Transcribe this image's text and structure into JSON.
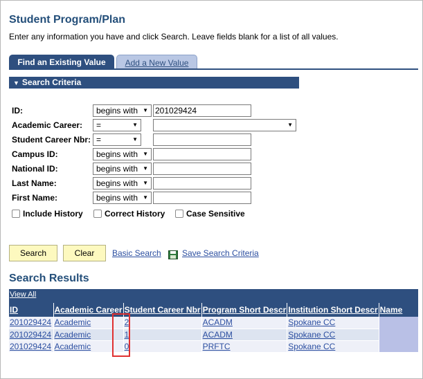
{
  "page": {
    "title": "Student Program/Plan",
    "instructions": "Enter any information you have and click Search. Leave fields blank for a list of all values."
  },
  "tabs": {
    "find_existing": "Find an Existing Value",
    "add_new": "Add a New Value"
  },
  "search_criteria": {
    "header": "Search Criteria",
    "fields": {
      "id": {
        "label": "ID:",
        "operator": "begins with",
        "value": "201029424"
      },
      "academic_career": {
        "label": "Academic Career:",
        "operator": "=",
        "value": ""
      },
      "student_career_nbr": {
        "label": "Student Career Nbr:",
        "operator": "=",
        "value": ""
      },
      "campus_id": {
        "label": "Campus ID:",
        "operator": "begins with",
        "value": ""
      },
      "national_id": {
        "label": "National ID:",
        "operator": "begins with",
        "value": ""
      },
      "last_name": {
        "label": "Last Name:",
        "operator": "begins with",
        "value": ""
      },
      "first_name": {
        "label": "First Name:",
        "operator": "begins with",
        "value": ""
      }
    },
    "checkboxes": {
      "include_history": "Include History",
      "correct_history": "Correct History",
      "case_sensitive": "Case Sensitive"
    }
  },
  "actions": {
    "search": "Search",
    "clear": "Clear",
    "basic_search": "Basic Search",
    "save_search_criteria": "Save Search Criteria"
  },
  "results": {
    "title": "Search Results",
    "view_all": "View All",
    "columns": [
      "ID",
      "Academic Career",
      "Student Career Nbr",
      "Program Short Descr",
      "Institution Short Descr",
      "Name"
    ],
    "rows": [
      [
        "201029424",
        "Academic",
        "2",
        "ACADM",
        "Spokane CC",
        ""
      ],
      [
        "201029424",
        "Academic",
        "1",
        "ACADM",
        "Spokane CC",
        ""
      ],
      [
        "201029424",
        "Academic",
        "0",
        "PRFTC",
        "Spokane CC",
        ""
      ]
    ]
  },
  "colors": {
    "brand_navy": "#2e4f7f",
    "title_blue": "#244f7a",
    "button_yellow": "#fdf9bf",
    "highlight_red": "#e03030"
  }
}
